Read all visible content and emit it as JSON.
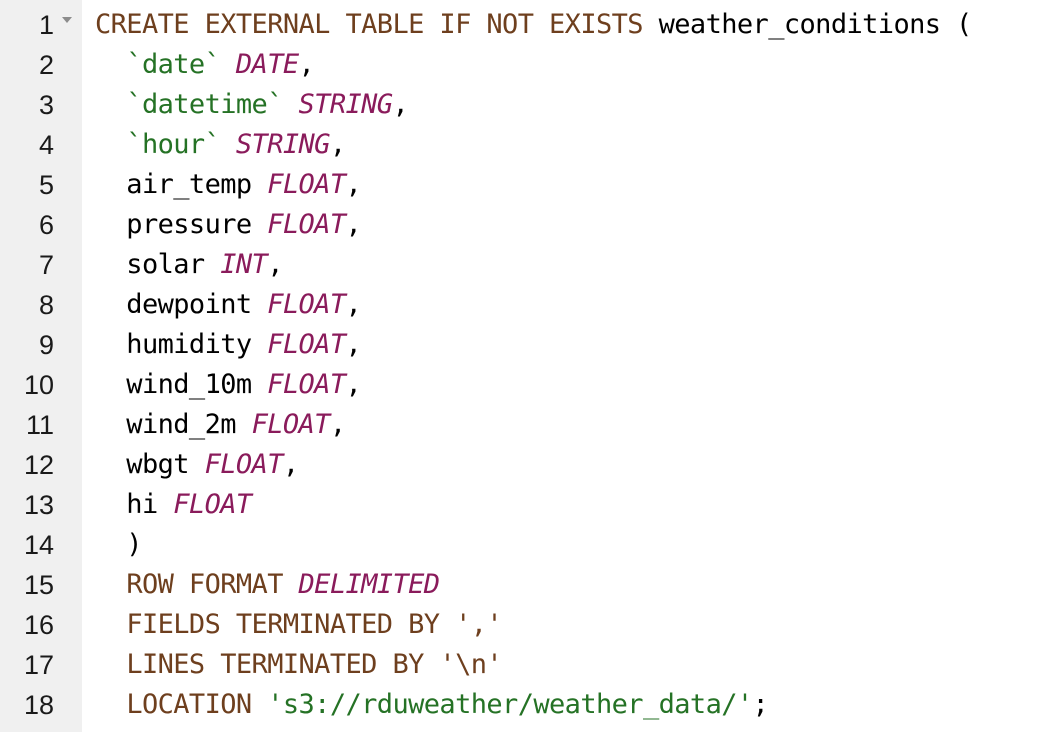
{
  "editor": {
    "lines": [
      {
        "num": "1",
        "tokens": [
          {
            "t": "CREATE EXTERNAL TABLE IF NOT EXISTS",
            "c": "kw"
          },
          {
            "t": " weather_conditions (",
            "c": "pl"
          }
        ]
      },
      {
        "num": "2",
        "tokens": [
          {
            "t": "  ",
            "c": "pl"
          },
          {
            "t": "`date`",
            "c": "str"
          },
          {
            "t": " ",
            "c": "pl"
          },
          {
            "t": "DATE",
            "c": "ty"
          },
          {
            "t": ",",
            "c": "pl"
          }
        ]
      },
      {
        "num": "3",
        "tokens": [
          {
            "t": "  ",
            "c": "pl"
          },
          {
            "t": "`datetime`",
            "c": "str"
          },
          {
            "t": " ",
            "c": "pl"
          },
          {
            "t": "STRING",
            "c": "ty"
          },
          {
            "t": ",",
            "c": "pl"
          }
        ]
      },
      {
        "num": "4",
        "tokens": [
          {
            "t": "  ",
            "c": "pl"
          },
          {
            "t": "`hour`",
            "c": "str"
          },
          {
            "t": " ",
            "c": "pl"
          },
          {
            "t": "STRING",
            "c": "ty"
          },
          {
            "t": ",",
            "c": "pl"
          }
        ]
      },
      {
        "num": "5",
        "tokens": [
          {
            "t": "  air_temp ",
            "c": "pl"
          },
          {
            "t": "FLOAT",
            "c": "ty"
          },
          {
            "t": ",",
            "c": "pl"
          }
        ]
      },
      {
        "num": "6",
        "tokens": [
          {
            "t": "  pressure ",
            "c": "pl"
          },
          {
            "t": "FLOAT",
            "c": "ty"
          },
          {
            "t": ",",
            "c": "pl"
          }
        ]
      },
      {
        "num": "7",
        "tokens": [
          {
            "t": "  solar ",
            "c": "pl"
          },
          {
            "t": "INT",
            "c": "ty"
          },
          {
            "t": ",",
            "c": "pl"
          }
        ]
      },
      {
        "num": "8",
        "tokens": [
          {
            "t": "  dewpoint ",
            "c": "pl"
          },
          {
            "t": "FLOAT",
            "c": "ty"
          },
          {
            "t": ",",
            "c": "pl"
          }
        ]
      },
      {
        "num": "9",
        "tokens": [
          {
            "t": "  humidity ",
            "c": "pl"
          },
          {
            "t": "FLOAT",
            "c": "ty"
          },
          {
            "t": ",",
            "c": "pl"
          }
        ]
      },
      {
        "num": "10",
        "tokens": [
          {
            "t": "  wind_10m ",
            "c": "pl"
          },
          {
            "t": "FLOAT",
            "c": "ty"
          },
          {
            "t": ",",
            "c": "pl"
          }
        ]
      },
      {
        "num": "11",
        "tokens": [
          {
            "t": "  wind_2m ",
            "c": "pl"
          },
          {
            "t": "FLOAT",
            "c": "ty"
          },
          {
            "t": ",",
            "c": "pl"
          }
        ]
      },
      {
        "num": "12",
        "tokens": [
          {
            "t": "  wbgt ",
            "c": "pl"
          },
          {
            "t": "FLOAT",
            "c": "ty"
          },
          {
            "t": ",",
            "c": "pl"
          }
        ]
      },
      {
        "num": "13",
        "tokens": [
          {
            "t": "  hi ",
            "c": "pl"
          },
          {
            "t": "FLOAT",
            "c": "ty"
          }
        ]
      },
      {
        "num": "14",
        "tokens": [
          {
            "t": "  )",
            "c": "pl"
          }
        ]
      },
      {
        "num": "15",
        "tokens": [
          {
            "t": "  ",
            "c": "pl"
          },
          {
            "t": "ROW FORMAT",
            "c": "kw"
          },
          {
            "t": " ",
            "c": "pl"
          },
          {
            "t": "DELIMITED",
            "c": "ty"
          }
        ]
      },
      {
        "num": "16",
        "tokens": [
          {
            "t": "  ",
            "c": "pl"
          },
          {
            "t": "FIELDS TERMINATED BY",
            "c": "kw"
          },
          {
            "t": " ",
            "c": "pl"
          },
          {
            "t": "','",
            "c": "kw"
          }
        ]
      },
      {
        "num": "17",
        "tokens": [
          {
            "t": "  ",
            "c": "pl"
          },
          {
            "t": "LINES TERMINATED BY",
            "c": "kw"
          },
          {
            "t": " ",
            "c": "pl"
          },
          {
            "t": "'\\n'",
            "c": "kw"
          }
        ]
      },
      {
        "num": "18",
        "tokens": [
          {
            "t": "  ",
            "c": "pl"
          },
          {
            "t": "LOCATION",
            "c": "kw"
          },
          {
            "t": " ",
            "c": "pl"
          },
          {
            "t": "'s3://rduweather/weather_data/'",
            "c": "str"
          },
          {
            "t": ";",
            "c": "pl"
          }
        ]
      }
    ],
    "colors": {
      "keyword": "#6e3f1e",
      "type": "#8a1b5b",
      "string": "#257225",
      "plain": "#000000",
      "gutter_bg": "#f0f0f0",
      "fold_marker": "#8c8c8c"
    },
    "fold_marker": {
      "line": "1",
      "icon": "caret-down-icon"
    }
  }
}
